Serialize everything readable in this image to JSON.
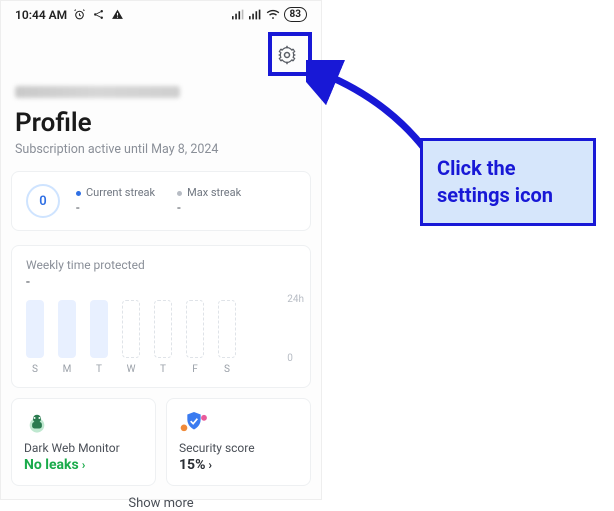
{
  "statusbar": {
    "time": "10:44 AM",
    "battery": "83"
  },
  "header": {
    "settings_icon": "settings-gear-icon"
  },
  "profile": {
    "title": "Profile",
    "subscription": "Subscription active until May 8, 2024"
  },
  "streak": {
    "circle_value": "0",
    "current_label": "Current streak",
    "current_value": "-",
    "max_label": "Max streak",
    "max_value": "-"
  },
  "weekly": {
    "title": "Weekly time protected",
    "value": "-",
    "y_top": "24h",
    "y_bottom": "0",
    "days": [
      "S",
      "M",
      "T",
      "W",
      "T",
      "F",
      "S"
    ]
  },
  "chart_data": {
    "type": "bar",
    "title": "Weekly time protected",
    "categories": [
      "S",
      "M",
      "T",
      "W",
      "T",
      "F",
      "S"
    ],
    "values": [
      null,
      null,
      null,
      null,
      null,
      null,
      null
    ],
    "ylabel": "hours",
    "ylim": [
      0,
      24
    ],
    "note": "No data recorded; first three bars rendered as placeholder filled, remaining four dashed"
  },
  "cards": {
    "dwm": {
      "label": "Dark Web Monitor",
      "value": "No leaks"
    },
    "score": {
      "label": "Security score",
      "value": "15%"
    }
  },
  "showmore": "Show more",
  "annotation": {
    "callout": "Click the settings icon"
  }
}
